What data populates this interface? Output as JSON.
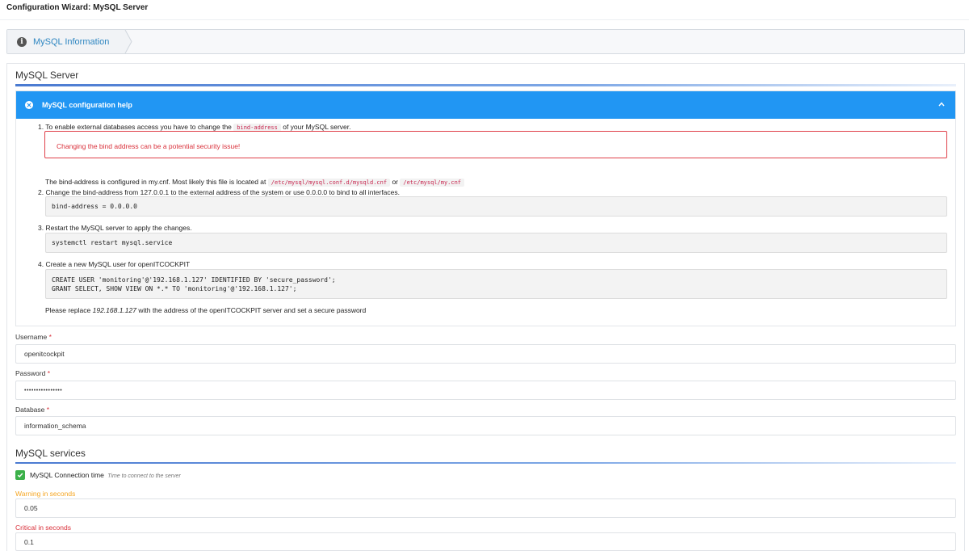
{
  "page": {
    "title": "Configuration Wizard: MySQL Server"
  },
  "wizard": {
    "step_label": "MySQL Information",
    "step_icon": "info-icon"
  },
  "section_server": {
    "title": "MySQL Server"
  },
  "help": {
    "title": "MySQL configuration help",
    "step1_pre": "1. To enable external databases access you have to change the",
    "step1_code": "bind-address",
    "step1_post": "of your MySQL server.",
    "alert": "Changing the bind address can be a potential security issue!",
    "cnf_pre": "The bind-address is configured in my.cnf. Most likely this file is located at",
    "cnf_path1": "/etc/mysql/mysql.conf.d/mysqld.cnf",
    "cnf_or": "or",
    "cnf_path2": "/etc/mysql/my.cnf",
    "step2": "2. Change the bind-address from 127.0.0.1 to the external address of the system or use 0.0.0.0 to bind to all interfaces.",
    "code2": "bind-address = 0.0.0.0",
    "step3": "3. Restart the MySQL server to apply the changes.",
    "code3": "systemctl restart mysql.service",
    "step4": "4. Create a new MySQL user for openITCOCKPIT",
    "code4_line1": "CREATE USER 'monitoring'@'192.168.1.127' IDENTIFIED BY 'secure_password';",
    "code4_line2": "GRANT SELECT, SHOW VIEW ON *.* TO 'monitoring'@'192.168.1.127';",
    "note_pre": "Please replace",
    "note_ip": "192.168.1.127",
    "note_post": "with the address of the openITCOCKPIT server and set a secure password"
  },
  "form": {
    "username_label": "Username",
    "username_value": "openitcockpit",
    "password_label": "Password",
    "password_value": "••••••••••••••••",
    "database_label": "Database",
    "database_value": "information_schema",
    "required_mark": "*"
  },
  "section_services": {
    "title": "MySQL services"
  },
  "service": {
    "name": "MySQL Connection time",
    "description": "Time to connect to the server",
    "checked": true,
    "warning_label": "Warning in seconds",
    "warning_value": "0.05",
    "critical_label": "Critical in seconds",
    "critical_value": "0.1"
  },
  "colors": {
    "accent": "#2196f3",
    "danger": "#d9303a",
    "warning": "#f5a623",
    "success": "#3cb14a"
  }
}
